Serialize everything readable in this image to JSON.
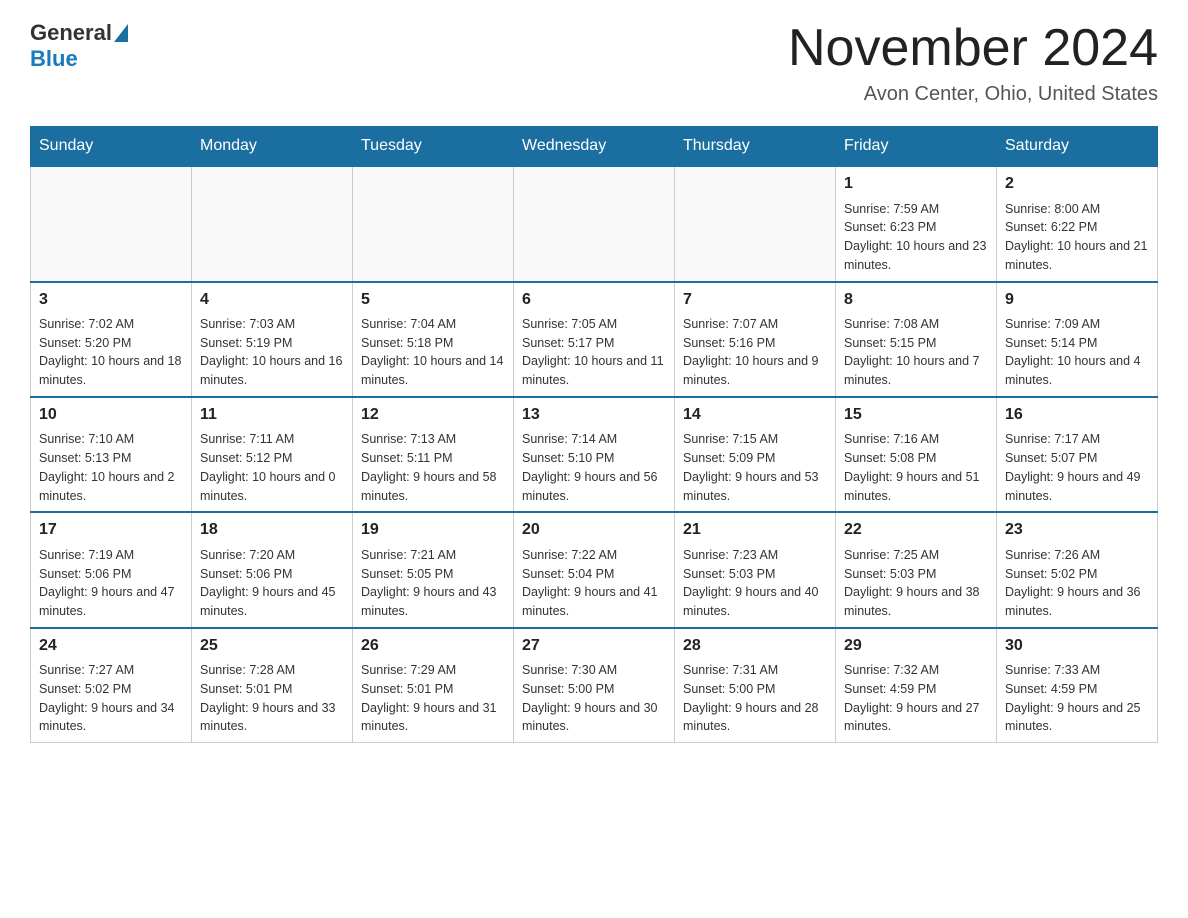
{
  "header": {
    "logo_general": "General",
    "logo_blue": "Blue",
    "title": "November 2024",
    "subtitle": "Avon Center, Ohio, United States"
  },
  "days_of_week": [
    "Sunday",
    "Monday",
    "Tuesday",
    "Wednesday",
    "Thursday",
    "Friday",
    "Saturday"
  ],
  "weeks": [
    [
      {
        "day": "",
        "info": ""
      },
      {
        "day": "",
        "info": ""
      },
      {
        "day": "",
        "info": ""
      },
      {
        "day": "",
        "info": ""
      },
      {
        "day": "",
        "info": ""
      },
      {
        "day": "1",
        "info": "Sunrise: 7:59 AM\nSunset: 6:23 PM\nDaylight: 10 hours and 23 minutes."
      },
      {
        "day": "2",
        "info": "Sunrise: 8:00 AM\nSunset: 6:22 PM\nDaylight: 10 hours and 21 minutes."
      }
    ],
    [
      {
        "day": "3",
        "info": "Sunrise: 7:02 AM\nSunset: 5:20 PM\nDaylight: 10 hours and 18 minutes."
      },
      {
        "day": "4",
        "info": "Sunrise: 7:03 AM\nSunset: 5:19 PM\nDaylight: 10 hours and 16 minutes."
      },
      {
        "day": "5",
        "info": "Sunrise: 7:04 AM\nSunset: 5:18 PM\nDaylight: 10 hours and 14 minutes."
      },
      {
        "day": "6",
        "info": "Sunrise: 7:05 AM\nSunset: 5:17 PM\nDaylight: 10 hours and 11 minutes."
      },
      {
        "day": "7",
        "info": "Sunrise: 7:07 AM\nSunset: 5:16 PM\nDaylight: 10 hours and 9 minutes."
      },
      {
        "day": "8",
        "info": "Sunrise: 7:08 AM\nSunset: 5:15 PM\nDaylight: 10 hours and 7 minutes."
      },
      {
        "day": "9",
        "info": "Sunrise: 7:09 AM\nSunset: 5:14 PM\nDaylight: 10 hours and 4 minutes."
      }
    ],
    [
      {
        "day": "10",
        "info": "Sunrise: 7:10 AM\nSunset: 5:13 PM\nDaylight: 10 hours and 2 minutes."
      },
      {
        "day": "11",
        "info": "Sunrise: 7:11 AM\nSunset: 5:12 PM\nDaylight: 10 hours and 0 minutes."
      },
      {
        "day": "12",
        "info": "Sunrise: 7:13 AM\nSunset: 5:11 PM\nDaylight: 9 hours and 58 minutes."
      },
      {
        "day": "13",
        "info": "Sunrise: 7:14 AM\nSunset: 5:10 PM\nDaylight: 9 hours and 56 minutes."
      },
      {
        "day": "14",
        "info": "Sunrise: 7:15 AM\nSunset: 5:09 PM\nDaylight: 9 hours and 53 minutes."
      },
      {
        "day": "15",
        "info": "Sunrise: 7:16 AM\nSunset: 5:08 PM\nDaylight: 9 hours and 51 minutes."
      },
      {
        "day": "16",
        "info": "Sunrise: 7:17 AM\nSunset: 5:07 PM\nDaylight: 9 hours and 49 minutes."
      }
    ],
    [
      {
        "day": "17",
        "info": "Sunrise: 7:19 AM\nSunset: 5:06 PM\nDaylight: 9 hours and 47 minutes."
      },
      {
        "day": "18",
        "info": "Sunrise: 7:20 AM\nSunset: 5:06 PM\nDaylight: 9 hours and 45 minutes."
      },
      {
        "day": "19",
        "info": "Sunrise: 7:21 AM\nSunset: 5:05 PM\nDaylight: 9 hours and 43 minutes."
      },
      {
        "day": "20",
        "info": "Sunrise: 7:22 AM\nSunset: 5:04 PM\nDaylight: 9 hours and 41 minutes."
      },
      {
        "day": "21",
        "info": "Sunrise: 7:23 AM\nSunset: 5:03 PM\nDaylight: 9 hours and 40 minutes."
      },
      {
        "day": "22",
        "info": "Sunrise: 7:25 AM\nSunset: 5:03 PM\nDaylight: 9 hours and 38 minutes."
      },
      {
        "day": "23",
        "info": "Sunrise: 7:26 AM\nSunset: 5:02 PM\nDaylight: 9 hours and 36 minutes."
      }
    ],
    [
      {
        "day": "24",
        "info": "Sunrise: 7:27 AM\nSunset: 5:02 PM\nDaylight: 9 hours and 34 minutes."
      },
      {
        "day": "25",
        "info": "Sunrise: 7:28 AM\nSunset: 5:01 PM\nDaylight: 9 hours and 33 minutes."
      },
      {
        "day": "26",
        "info": "Sunrise: 7:29 AM\nSunset: 5:01 PM\nDaylight: 9 hours and 31 minutes."
      },
      {
        "day": "27",
        "info": "Sunrise: 7:30 AM\nSunset: 5:00 PM\nDaylight: 9 hours and 30 minutes."
      },
      {
        "day": "28",
        "info": "Sunrise: 7:31 AM\nSunset: 5:00 PM\nDaylight: 9 hours and 28 minutes."
      },
      {
        "day": "29",
        "info": "Sunrise: 7:32 AM\nSunset: 4:59 PM\nDaylight: 9 hours and 27 minutes."
      },
      {
        "day": "30",
        "info": "Sunrise: 7:33 AM\nSunset: 4:59 PM\nDaylight: 9 hours and 25 minutes."
      }
    ]
  ]
}
